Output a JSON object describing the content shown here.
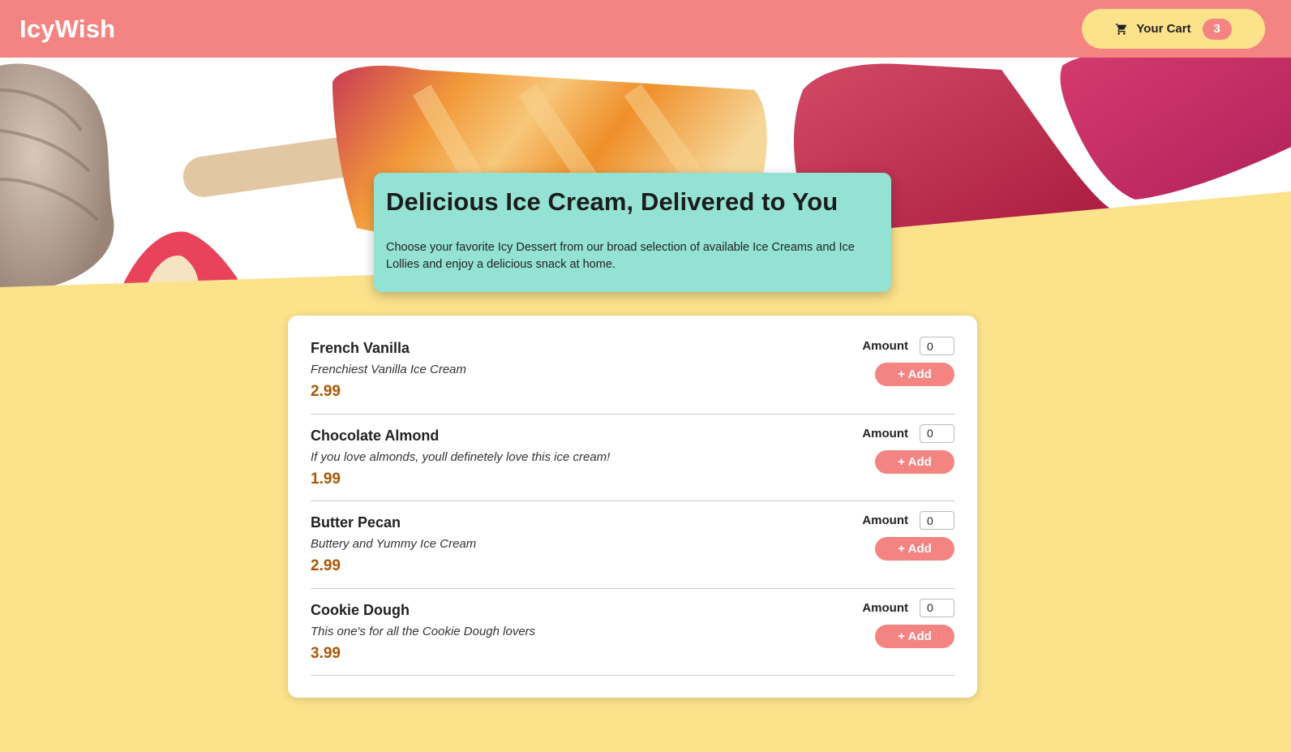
{
  "header": {
    "brand": "IcyWish",
    "cart_label": "Your Cart",
    "cart_count": "3"
  },
  "summary": {
    "title": "Delicious Ice Cream, Delivered to You",
    "text": "Choose your favorite Icy Dessert from our broad selection of available Ice Creams and Ice Lollies and enjoy a delicious snack at home."
  },
  "meals": {
    "amount_label": "Amount",
    "add_label": "+ Add",
    "items": [
      {
        "name": "French Vanilla",
        "description": "Frenchiest Vanilla Ice Cream",
        "price": "2.99",
        "amount": "0"
      },
      {
        "name": "Chocolate Almond",
        "description": "If you love almonds, youll definetely love this ice cream!",
        "price": "1.99",
        "amount": "0"
      },
      {
        "name": "Butter Pecan",
        "description": "Buttery and Yummy Ice Cream",
        "price": "2.99",
        "amount": "0"
      },
      {
        "name": "Cookie Dough",
        "description": "This one's for all the Cookie Dough lovers",
        "price": "3.99",
        "amount": "0"
      }
    ]
  },
  "colors": {
    "header": "#f48481",
    "background": "#fbe28b",
    "summary": "#94e2d4",
    "price": "#ad5502"
  }
}
